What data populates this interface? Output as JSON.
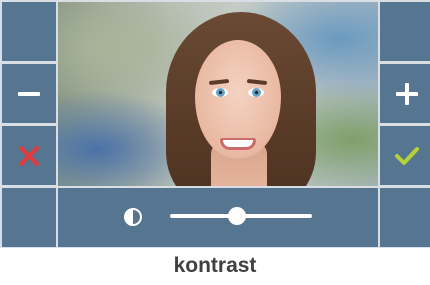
{
  "screen": {
    "caption": "kontrast"
  },
  "left_buttons": [
    {
      "icon": "none"
    },
    {
      "icon": "minus-icon"
    },
    {
      "icon": "close-icon",
      "color": "#e23a3a"
    },
    {
      "icon": "none"
    }
  ],
  "right_buttons": [
    {
      "icon": "none"
    },
    {
      "icon": "plus-icon"
    },
    {
      "icon": "checkmark-icon",
      "color": "#b5d334"
    },
    {
      "icon": "none"
    }
  ],
  "contrast_slider": {
    "icon": "contrast-icon",
    "level": 0.47
  },
  "colors": {
    "button": "#557591",
    "frame": "#d9dee4",
    "caption": "#404040"
  }
}
